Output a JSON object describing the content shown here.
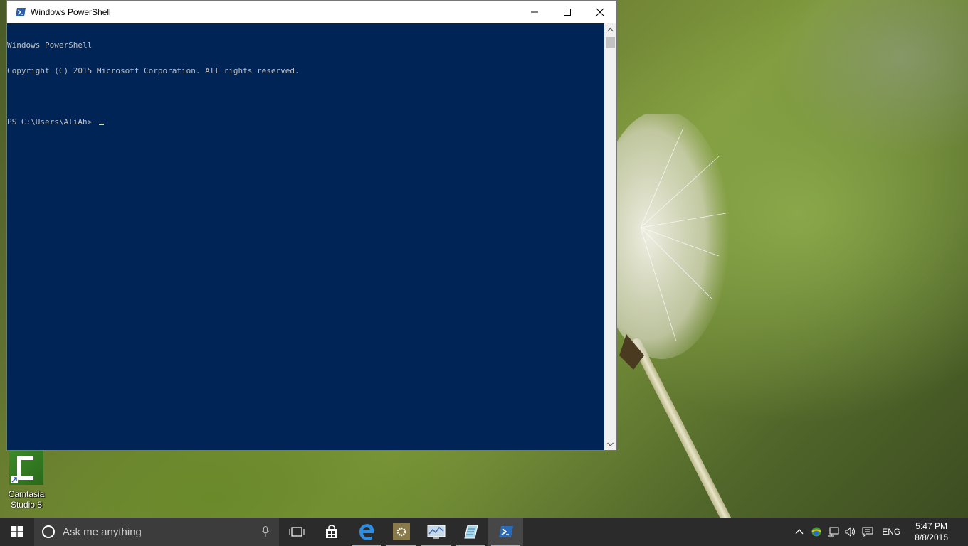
{
  "window": {
    "title": "Windows PowerShell",
    "console_lines": [
      "Windows PowerShell",
      "Copyright (C) 2015 Microsoft Corporation. All rights reserved.",
      "",
      "PS C:\\Users\\AliAh> "
    ],
    "controls": [
      "minimize-icon",
      "maximize-icon",
      "close-icon"
    ]
  },
  "desktop": {
    "icons": [
      {
        "label_line1": "Camtasia",
        "label_line2": "Studio 8"
      }
    ]
  },
  "taskbar": {
    "search_placeholder": "Ask me anything",
    "apps": [
      "task-view",
      "store",
      "edge",
      "settings",
      "network-monitor",
      "notepad",
      "powershell"
    ],
    "tray": {
      "language": "ENG",
      "time": "5:47 PM",
      "date": "8/8/2015"
    }
  },
  "colors": {
    "console_bg": "#012456",
    "console_text": "#c0c0c0",
    "taskbar_bg": "#2b2b2b"
  }
}
